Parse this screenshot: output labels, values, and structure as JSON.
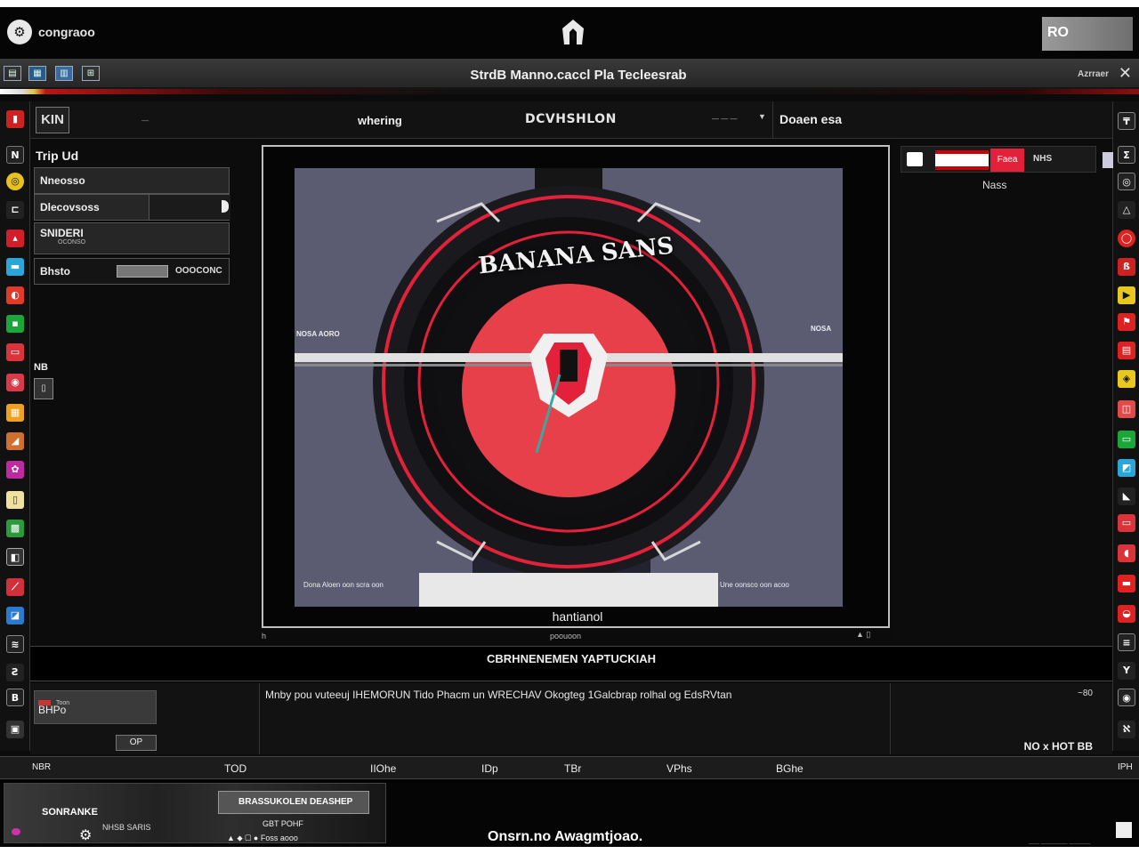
{
  "topbar": {
    "app_name": "congraoo",
    "right_button": "RO"
  },
  "menubar": {
    "icons": [
      "▤",
      "▦",
      "▥",
      "⊞"
    ],
    "title": "StrdB Manno.caccl Pla Tecleesrab",
    "right_label": "Azrraer",
    "close": "✕"
  },
  "toolbar": {
    "tool": "KIN",
    "small_text": "—",
    "mode_label": "whering",
    "mode_title": "DCVHSHLON",
    "zoom": "— — —",
    "right_label": "Doaen esa"
  },
  "left_panel": {
    "title": "Trip Ud",
    "fields": [
      {
        "label": "Nneosso"
      },
      {
        "label": "Dlecovsoss"
      },
      {
        "label": "SNIDERI",
        "sub": "OCONSO"
      },
      {
        "label": "Bhsto",
        "value": "OOOCONC"
      }
    ],
    "section": "NB",
    "chip": "▯"
  },
  "canvas": {
    "emblem_text": "BANANA SANS",
    "left_tag": "NOSA AORO",
    "right_tag": "NOSA",
    "bottom_left": "Dona Aloen oon scra oon",
    "bottom_right": "Une oonsco oon acoo",
    "caption": "hantianol",
    "foot_left": "h",
    "foot_center": "poouoon",
    "colors": {
      "bg": "#5b5b72",
      "accent": "#e3213a",
      "dark": "#151515",
      "teal": "#3aa8a0"
    }
  },
  "right_panel": {
    "badge": "Faea",
    "label": "NHS",
    "sub_label": "Nass"
  },
  "banner": {
    "text": "CBRHNENEMEN YAPTUCKIAH"
  },
  "props": {
    "small_label": "Toon",
    "box_label": "BHPo",
    "button": "OP",
    "description": "Mnby pou vuteeuj IHEMORUN Tido Phacm un WRECHAV Okogteg 1Galcbrap rolhal og EdsRVtan",
    "right_top": "~80",
    "right_bottom": "NO x HOT BB"
  },
  "ruler": {
    "labels": [
      "NBR",
      "TOD",
      "IIOhe",
      "IDp",
      "TBr",
      "VPhs",
      "BGhe",
      "IPH"
    ]
  },
  "tray": {
    "thumb_title": "SONRANKE",
    "thumb_sub": "NHSB SARIS",
    "card_title": "BRASSUKOLEN DEASHEP",
    "card_sub": "GBT POHF",
    "card_icons": "▲ ⬥ ▢ ● Foss aooo",
    "center": "Onsrn.no Awagmtjoao.",
    "right": "—— ————— ————"
  }
}
